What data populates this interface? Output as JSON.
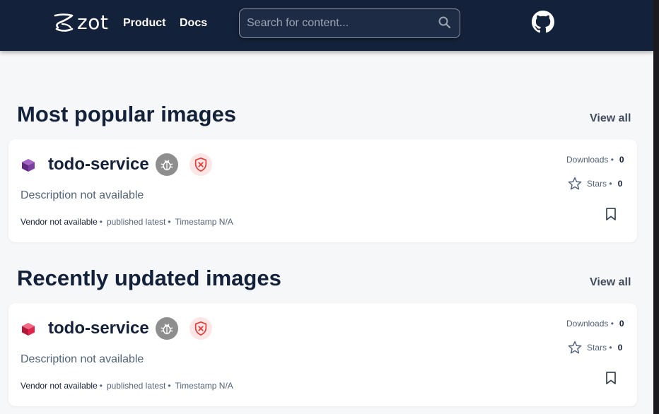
{
  "header": {
    "logo_text": "zot",
    "nav": {
      "product": "Product",
      "docs": "Docs"
    },
    "search_placeholder": "Search for content..."
  },
  "sections": [
    {
      "title": "Most popular images",
      "view_all": "View all",
      "card": {
        "name": "todo-service",
        "cube_color": "#7a3fa0",
        "description": "Description not available",
        "vendor": "Vendor not available",
        "version": "published latest",
        "timestamp": "Timestamp N/A",
        "downloads_label": "Downloads",
        "downloads": "0",
        "stars_label": "Stars",
        "stars": "0"
      }
    },
    {
      "title": "Recently updated images",
      "view_all": "View all",
      "card": {
        "name": "todo-service",
        "cube_color": "#e0244c",
        "description": "Description not available",
        "vendor": "Vendor not available",
        "version": "published latest",
        "timestamp": "Timestamp N/A",
        "downloads_label": "Downloads",
        "downloads": "0",
        "stars_label": "Stars",
        "stars": "0"
      }
    }
  ],
  "colors": {
    "topbar": "#14213a",
    "title": "#14213a",
    "bug_badge": "#8e8e8e",
    "shield_badge_bg": "#fde6e6",
    "shield_badge_fg": "#e53935"
  }
}
